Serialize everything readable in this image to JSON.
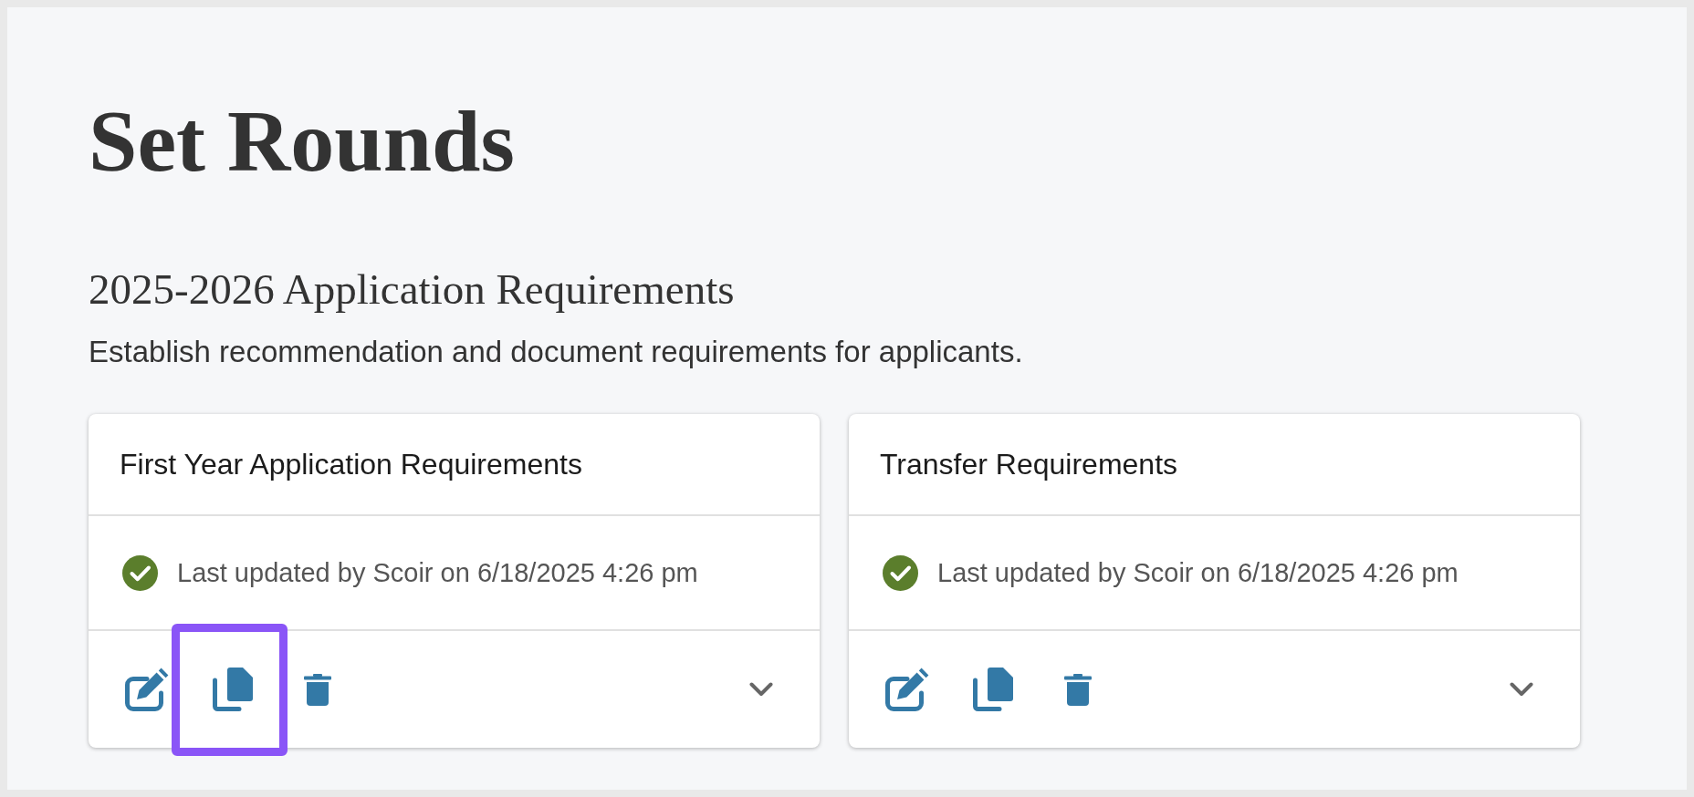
{
  "page": {
    "title": "Set Rounds"
  },
  "section": {
    "heading": "2025-2026 Application Requirements",
    "description": "Establish recommendation and document requirements for applicants."
  },
  "cards": [
    {
      "title": "First Year Application Requirements",
      "status": {
        "kind": "complete",
        "text": "Last updated by Scoir on 6/18/2025 4:26 pm"
      },
      "actions": [
        {
          "kind": "edit",
          "highlighted": false
        },
        {
          "kind": "copy",
          "highlighted": true
        },
        {
          "kind": "delete",
          "highlighted": false
        }
      ],
      "expanded": false
    },
    {
      "title": "Transfer Requirements",
      "status": {
        "kind": "complete",
        "text": "Last updated by Scoir on 6/18/2025 4:26 pm"
      },
      "actions": [
        {
          "kind": "edit",
          "highlighted": false
        },
        {
          "kind": "copy",
          "highlighted": false
        },
        {
          "kind": "delete",
          "highlighted": false
        }
      ],
      "expanded": false
    }
  ]
}
